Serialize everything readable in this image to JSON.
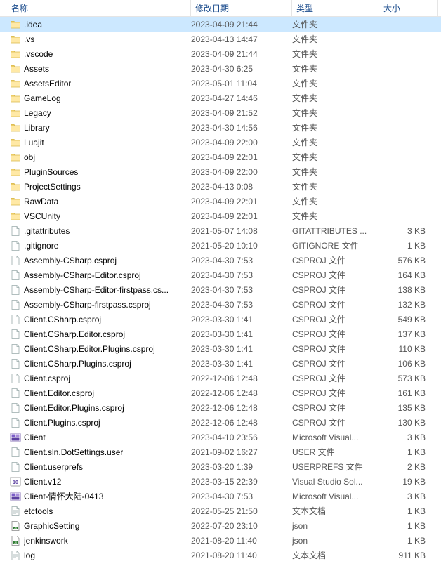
{
  "columns": {
    "name": "名称",
    "date": "修改日期",
    "type": "类型",
    "size": "大小"
  },
  "rows": [
    {
      "icon": "folder",
      "name": ".idea",
      "date": "2023-04-09 21:44",
      "type": "文件夹",
      "size": "",
      "selected": true
    },
    {
      "icon": "folder",
      "name": ".vs",
      "date": "2023-04-13 14:47",
      "type": "文件夹",
      "size": ""
    },
    {
      "icon": "folder",
      "name": ".vscode",
      "date": "2023-04-09 21:44",
      "type": "文件夹",
      "size": ""
    },
    {
      "icon": "folder",
      "name": "Assets",
      "date": "2023-04-30 6:25",
      "type": "文件夹",
      "size": ""
    },
    {
      "icon": "folder",
      "name": "AssetsEditor",
      "date": "2023-05-01 11:04",
      "type": "文件夹",
      "size": ""
    },
    {
      "icon": "folder",
      "name": "GameLog",
      "date": "2023-04-27 14:46",
      "type": "文件夹",
      "size": ""
    },
    {
      "icon": "folder",
      "name": "Legacy",
      "date": "2023-04-09 21:52",
      "type": "文件夹",
      "size": ""
    },
    {
      "icon": "folder",
      "name": "Library",
      "date": "2023-04-30 14:56",
      "type": "文件夹",
      "size": ""
    },
    {
      "icon": "folder",
      "name": "Luajit",
      "date": "2023-04-09 22:00",
      "type": "文件夹",
      "size": ""
    },
    {
      "icon": "folder",
      "name": "obj",
      "date": "2023-04-09 22:01",
      "type": "文件夹",
      "size": ""
    },
    {
      "icon": "folder",
      "name": "PluginSources",
      "date": "2023-04-09 22:00",
      "type": "文件夹",
      "size": ""
    },
    {
      "icon": "folder",
      "name": "ProjectSettings",
      "date": "2023-04-13 0:08",
      "type": "文件夹",
      "size": ""
    },
    {
      "icon": "folder",
      "name": "RawData",
      "date": "2023-04-09 22:01",
      "type": "文件夹",
      "size": ""
    },
    {
      "icon": "folder",
      "name": "VSCUnity",
      "date": "2023-04-09 22:01",
      "type": "文件夹",
      "size": ""
    },
    {
      "icon": "file",
      "name": ".gitattributes",
      "date": "2021-05-07 14:08",
      "type": "GITATTRIBUTES ...",
      "size": "3 KB"
    },
    {
      "icon": "file",
      "name": ".gitignore",
      "date": "2021-05-20 10:10",
      "type": "GITIGNORE 文件",
      "size": "1 KB"
    },
    {
      "icon": "file",
      "name": "Assembly-CSharp.csproj",
      "date": "2023-04-30 7:53",
      "type": "CSPROJ 文件",
      "size": "576 KB"
    },
    {
      "icon": "file",
      "name": "Assembly-CSharp-Editor.csproj",
      "date": "2023-04-30 7:53",
      "type": "CSPROJ 文件",
      "size": "164 KB"
    },
    {
      "icon": "file",
      "name": "Assembly-CSharp-Editor-firstpass.cs...",
      "date": "2023-04-30 7:53",
      "type": "CSPROJ 文件",
      "size": "138 KB"
    },
    {
      "icon": "file",
      "name": "Assembly-CSharp-firstpass.csproj",
      "date": "2023-04-30 7:53",
      "type": "CSPROJ 文件",
      "size": "132 KB"
    },
    {
      "icon": "file",
      "name": "Client.CSharp.csproj",
      "date": "2023-03-30 1:41",
      "type": "CSPROJ 文件",
      "size": "549 KB"
    },
    {
      "icon": "file",
      "name": "Client.CSharp.Editor.csproj",
      "date": "2023-03-30 1:41",
      "type": "CSPROJ 文件",
      "size": "137 KB"
    },
    {
      "icon": "file",
      "name": "Client.CSharp.Editor.Plugins.csproj",
      "date": "2023-03-30 1:41",
      "type": "CSPROJ 文件",
      "size": "110 KB"
    },
    {
      "icon": "file",
      "name": "Client.CSharp.Plugins.csproj",
      "date": "2023-03-30 1:41",
      "type": "CSPROJ 文件",
      "size": "106 KB"
    },
    {
      "icon": "file",
      "name": "Client.csproj",
      "date": "2022-12-06 12:48",
      "type": "CSPROJ 文件",
      "size": "573 KB"
    },
    {
      "icon": "file",
      "name": "Client.Editor.csproj",
      "date": "2022-12-06 12:48",
      "type": "CSPROJ 文件",
      "size": "161 KB"
    },
    {
      "icon": "file",
      "name": "Client.Editor.Plugins.csproj",
      "date": "2022-12-06 12:48",
      "type": "CSPROJ 文件",
      "size": "135 KB"
    },
    {
      "icon": "file",
      "name": "Client.Plugins.csproj",
      "date": "2022-12-06 12:48",
      "type": "CSPROJ 文件",
      "size": "130 KB"
    },
    {
      "icon": "sln",
      "name": "Client",
      "date": "2023-04-10 23:56",
      "type": "Microsoft Visual...",
      "size": "3 KB"
    },
    {
      "icon": "file",
      "name": "Client.sln.DotSettings.user",
      "date": "2021-09-02 16:27",
      "type": "USER 文件",
      "size": "1 KB"
    },
    {
      "icon": "file",
      "name": "Client.userprefs",
      "date": "2023-03-20 1:39",
      "type": "USERPREFS 文件",
      "size": "2 KB"
    },
    {
      "icon": "sln2",
      "name": "Client.v12",
      "date": "2023-03-15 22:39",
      "type": "Visual Studio Sol...",
      "size": "19 KB"
    },
    {
      "icon": "sln",
      "name": "Client-情怀大陆-0413",
      "date": "2023-04-30 7:53",
      "type": "Microsoft Visual...",
      "size": "3 KB"
    },
    {
      "icon": "text",
      "name": "etctools",
      "date": "2022-05-25 21:50",
      "type": "文本文档",
      "size": "1 KB"
    },
    {
      "icon": "json",
      "name": "GraphicSetting",
      "date": "2022-07-20 23:10",
      "type": "json",
      "size": "1 KB"
    },
    {
      "icon": "json",
      "name": "jenkinswork",
      "date": "2021-08-20 11:40",
      "type": "json",
      "size": "1 KB"
    },
    {
      "icon": "text",
      "name": "log",
      "date": "2021-08-20 11:40",
      "type": "文本文档",
      "size": "911 KB"
    }
  ]
}
